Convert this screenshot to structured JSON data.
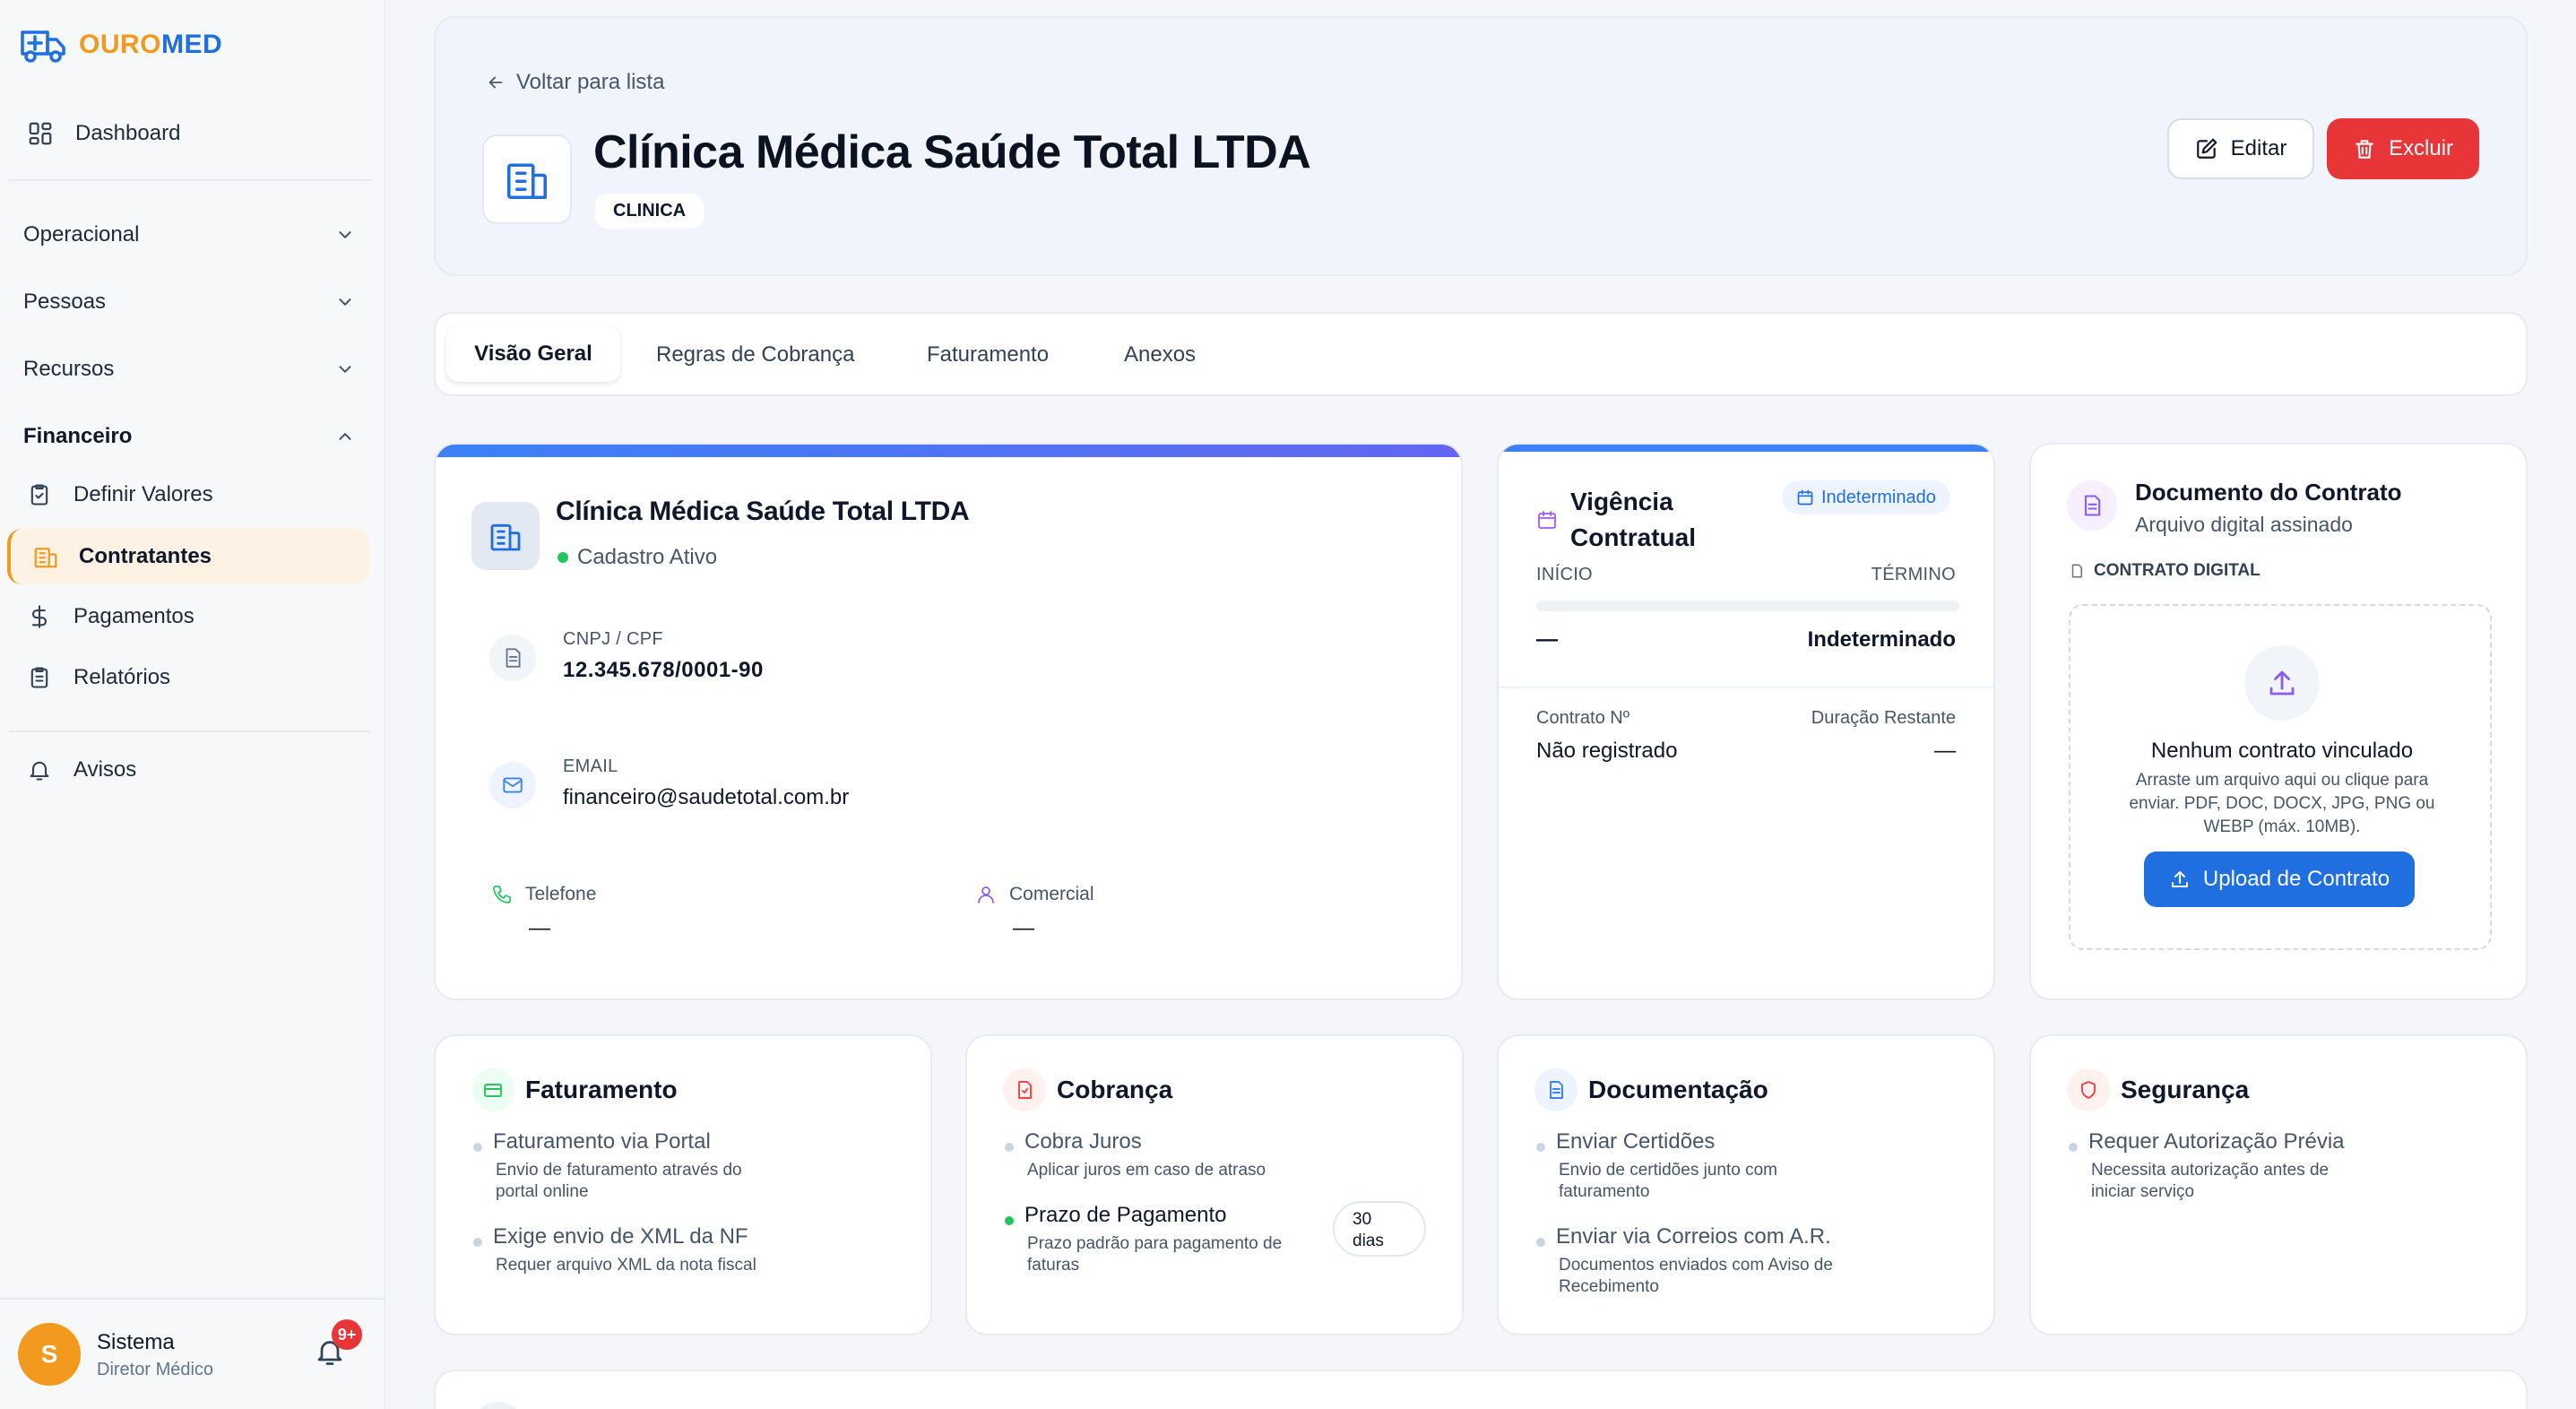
{
  "brand": {
    "name_part1": "OURO",
    "name_part2": "MED"
  },
  "sidebar": {
    "dashboard": "Dashboard",
    "groups": [
      "Operacional",
      "Pessoas",
      "Recursos",
      "Financeiro"
    ],
    "financeiro_items": [
      "Definir Valores",
      "Contratantes",
      "Pagamentos",
      "Relatórios"
    ],
    "avisos": "Avisos",
    "user": {
      "initial": "S",
      "name": "Sistema",
      "role": "Diretor Médico",
      "notifications": "9+"
    }
  },
  "header": {
    "back": "Voltar para lista",
    "title": "Clínica Médica Saúde Total LTDA",
    "badge": "CLINICA",
    "edit": "Editar",
    "delete": "Excluir"
  },
  "tabs": [
    "Visão Geral",
    "Regras de Cobrança",
    "Faturamento",
    "Anexos"
  ],
  "overview": {
    "name": "Clínica Médica Saúde Total LTDA",
    "status": "Cadastro Ativo",
    "cnpj_label": "CNPJ / CPF",
    "cnpj": "12.345.678/0001-90",
    "email_label": "EMAIL",
    "email": "financeiro@saudetotal.com.br",
    "phone_label": "Telefone",
    "phone": "—",
    "comercial_label": "Comercial",
    "comercial": "—"
  },
  "vigencia": {
    "title_line1": "Vigência",
    "title_line2": "Contratual",
    "badge": "Indeterminado",
    "inicio_label": "INÍCIO",
    "termino_label": "TÉRMINO",
    "inicio": "—",
    "termino": "Indeterminado",
    "contrato_label": "Contrato Nº",
    "contrato": "Não registrado",
    "duracao_label": "Duração Restante",
    "duracao": "—"
  },
  "documento": {
    "title": "Documento do Contrato",
    "subtitle": "Arquivo digital assinado",
    "section": "CONTRATO DIGITAL",
    "empty_title": "Nenhum contrato vinculado",
    "empty_desc_1": "Arraste um arquivo aqui ou clique para",
    "empty_desc_2": "enviar. PDF, DOC, DOCX, JPG, PNG ou",
    "empty_desc_3": "WEBP (máx. 10MB).",
    "upload": "Upload de Contrato"
  },
  "rules": {
    "faturamento": {
      "title": "Faturamento",
      "i1_t": "Faturamento via Portal",
      "i1_d1": "Envio de faturamento através do",
      "i1_d2": "portal online",
      "i2_t": "Exige envio de XML da NF",
      "i2_d1": "Requer arquivo XML da nota fiscal"
    },
    "cobranca": {
      "title": "Cobrança",
      "i1_t": "Cobra Juros",
      "i1_d1": "Aplicar juros em caso de atraso",
      "i2_t": "Prazo de Pagamento",
      "i2_d1": "Prazo padrão para pagamento de",
      "i2_d2": "faturas",
      "i2_badge_1": "30",
      "i2_badge_2": "dias"
    },
    "documentacao": {
      "title": "Documentação",
      "i1_t": "Enviar Certidões",
      "i1_d1": "Envio de certidões junto com",
      "i1_d2": "faturamento",
      "i2_t": "Enviar via Correios com A.R.",
      "i2_d1": "Documentos enviados com Aviso de",
      "i2_d2": "Recebimento"
    },
    "seguranca": {
      "title": "Segurança",
      "i1_t": "Requer Autorização Prévia",
      "i1_d1": "Necessita autorização antes de",
      "i1_d2": "iniciar serviço"
    }
  },
  "colors": {
    "accent": "#1f6fe0",
    "brand_orange": "#f39a1e",
    "danger": "#e83538",
    "success": "#22c55e"
  }
}
